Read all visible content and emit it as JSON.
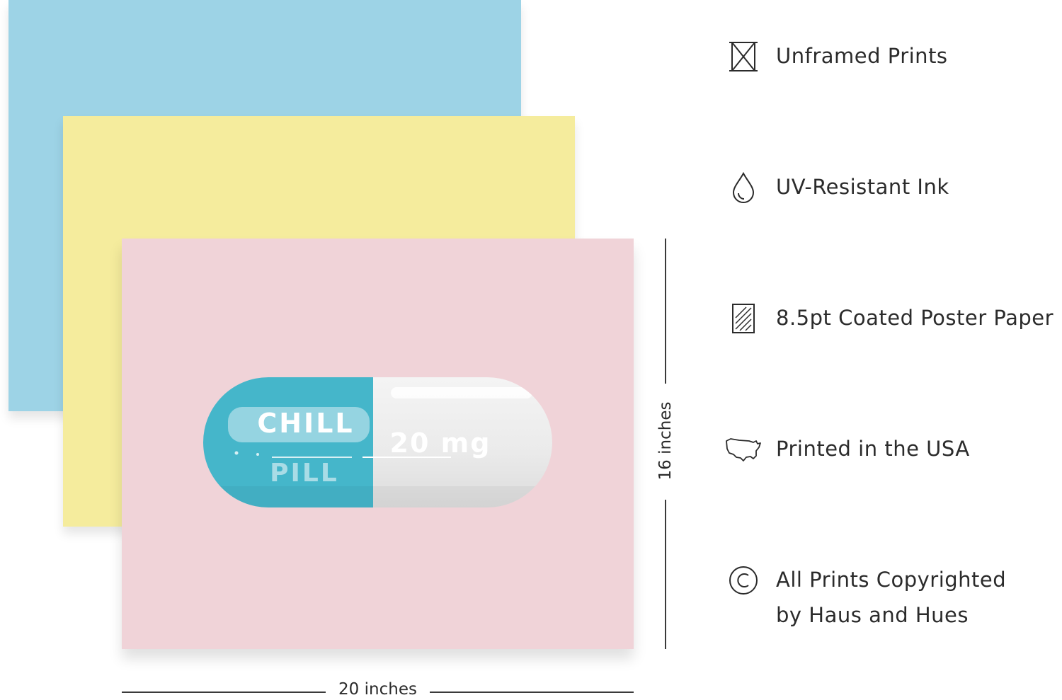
{
  "print": {
    "pill_top_text": "CHILL",
    "pill_bottom_text": "PILL",
    "pill_dose_text": "20 mg",
    "sheet_colors": {
      "blue": "#9dd3e6",
      "yellow": "#f5ec9d",
      "pink": "#f0d3d8"
    }
  },
  "dimensions": {
    "width_label": "20 inches",
    "height_label": "16 inches"
  },
  "features": [
    {
      "icon": "unframed-icon",
      "label": "Unframed Prints"
    },
    {
      "icon": "ink-drop-icon",
      "label": "UV-Resistant Ink"
    },
    {
      "icon": "paper-icon",
      "label": "8.5pt Coated Poster Paper"
    },
    {
      "icon": "usa-map-icon",
      "label": "Printed in the USA"
    },
    {
      "icon": "copyright-icon",
      "label": "All Prints Copyrighted",
      "label2": "by Haus and Hues"
    }
  ]
}
